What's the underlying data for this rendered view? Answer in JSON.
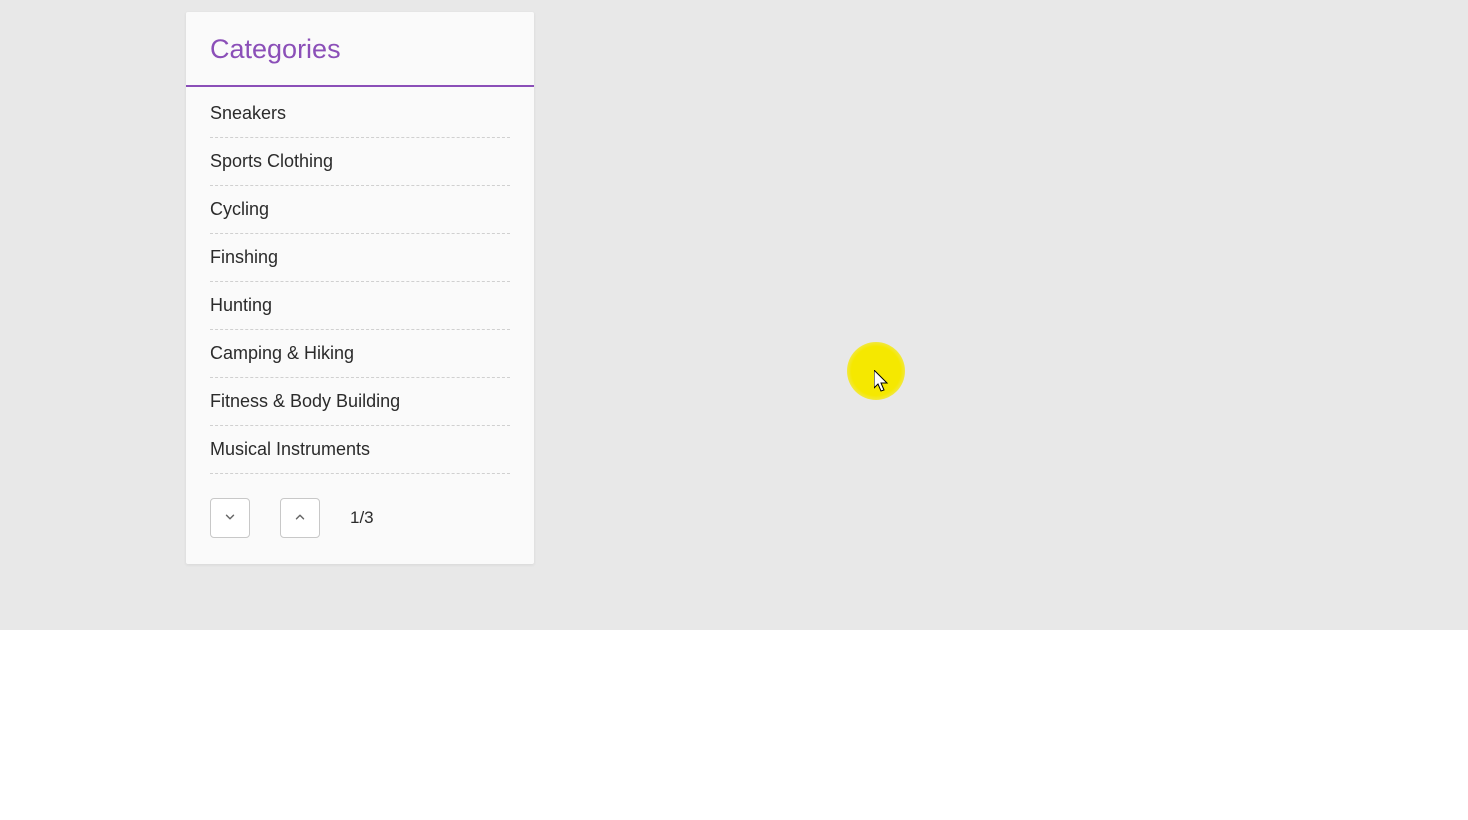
{
  "panel": {
    "title": "Categories",
    "items": [
      "Sneakers",
      "Sports Clothing",
      "Cycling",
      "Finshing",
      "Hunting",
      "Camping & Hiking",
      "Fitness & Body Building",
      "Musical Instruments"
    ],
    "pagination": "1/3"
  },
  "colors": {
    "accent": "#8b4fb8",
    "highlight": "#f5e800"
  }
}
